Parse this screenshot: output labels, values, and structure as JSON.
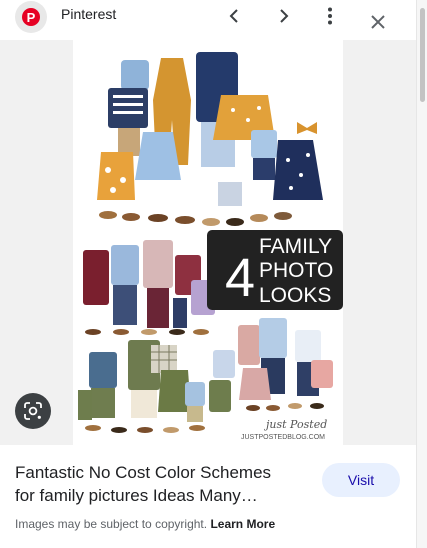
{
  "header": {
    "site_name": "Pinterest",
    "logo_letter": "P",
    "brand_color": "#e60023"
  },
  "image": {
    "overlay_text_1": "4",
    "overlay_text_2": "FAMILY",
    "overlay_text_3": "PHOTO",
    "overlay_text_4": "LOOKS",
    "watermark_script": "just Posted",
    "watermark_url": "JUSTPOSTEDBLOG.COM"
  },
  "result": {
    "title": "Fantastic No Cost Color Schemes for family pictures Ideas Many…",
    "visit_label": "Visit",
    "copyright_text": "Images may be subject to copyright.",
    "learn_more_label": "Learn More"
  },
  "colors": {
    "accent_bg": "#e8f0fe",
    "accent_text": "#1a0dab",
    "viewer_bg": "#f1f1f1"
  }
}
